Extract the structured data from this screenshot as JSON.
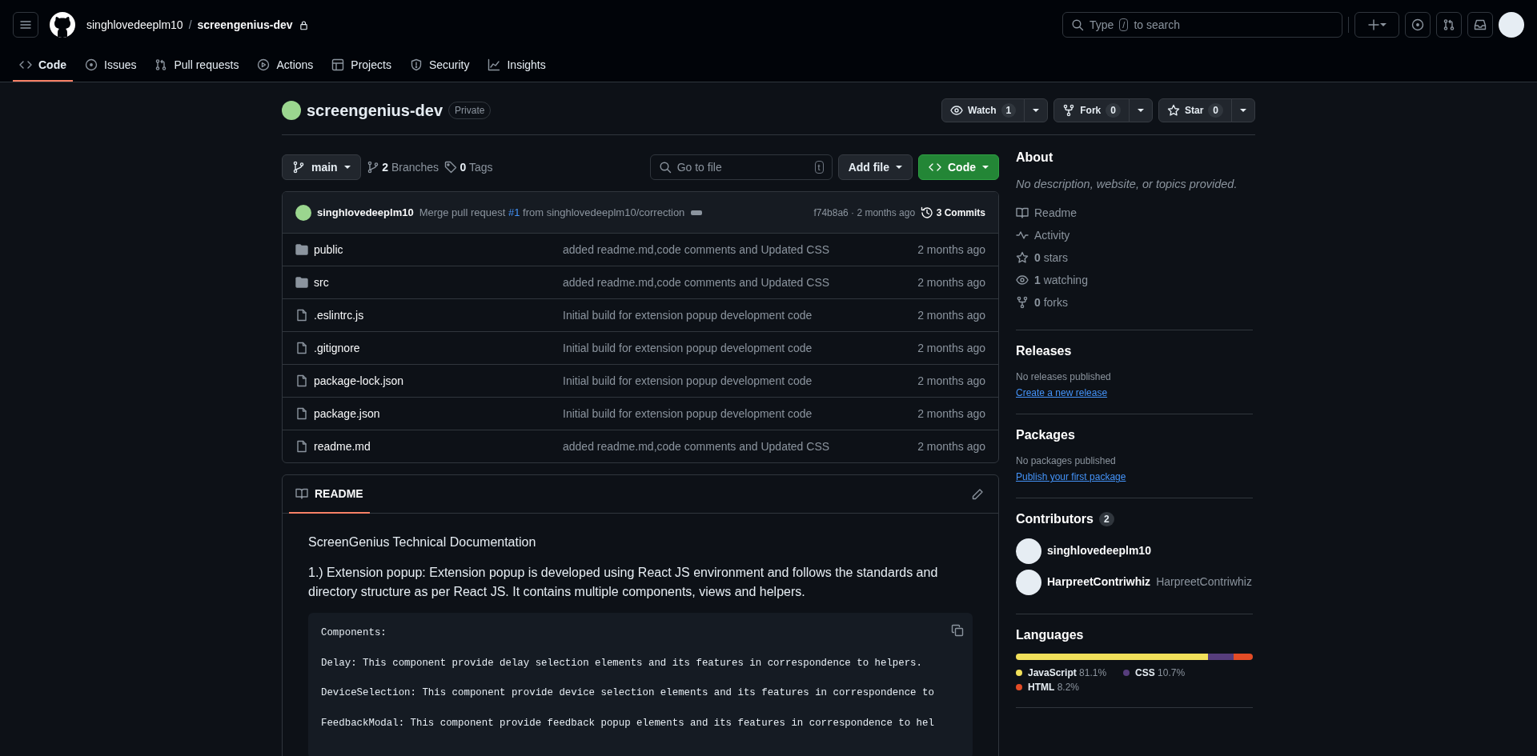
{
  "header": {
    "owner": "singhlovedeeplm10",
    "separator": "/",
    "repo": "screengenius-dev",
    "search": {
      "prefix": "Type",
      "key": "/",
      "suffix": "to search"
    }
  },
  "repo_tabs": [
    {
      "kind": "code",
      "label": "Code",
      "selected": true
    },
    {
      "kind": "issues",
      "label": "Issues",
      "selected": false
    },
    {
      "kind": "pulls",
      "label": "Pull requests",
      "selected": false
    },
    {
      "kind": "actions",
      "label": "Actions",
      "selected": false
    },
    {
      "kind": "projects",
      "label": "Projects",
      "selected": false
    },
    {
      "kind": "security",
      "label": "Security",
      "selected": false
    },
    {
      "kind": "insights",
      "label": "Insights",
      "selected": false
    }
  ],
  "repo": {
    "name": "screengenius-dev",
    "visibility": "Private",
    "actions": [
      {
        "kind": "watch",
        "label": "Watch",
        "count": "1"
      },
      {
        "kind": "fork",
        "label": "Fork",
        "count": "0"
      },
      {
        "kind": "star",
        "label": "Star",
        "count": "0"
      }
    ]
  },
  "toolbar": {
    "branch": "main",
    "branches_count": "2",
    "branches_label": "Branches",
    "tags_count": "0",
    "tags_label": "Tags",
    "go_to_file_placeholder": "Go to file",
    "go_to_file_key": "t",
    "add_file": "Add file",
    "code_button": "Code"
  },
  "latest_commit": {
    "author": "singhlovedeeplm10",
    "message_prefix": "Merge pull request",
    "pr_link": "#1",
    "message_suffix": "from singhlovedeeplm10/correction",
    "hash_time": "f74b8a6 · 2 months ago",
    "commits": "3 Commits"
  },
  "files": [
    {
      "kind": "folder",
      "name": "public",
      "message": "added readme.md,code comments and Updated CSS",
      "time": "2 months ago"
    },
    {
      "kind": "folder",
      "name": "src",
      "message": "added readme.md,code comments and Updated CSS",
      "time": "2 months ago"
    },
    {
      "kind": "file",
      "name": ".eslintrc.js",
      "message": "Initial build for extension popup development code",
      "time": "2 months ago"
    },
    {
      "kind": "file",
      "name": ".gitignore",
      "message": "Initial build for extension popup development code",
      "time": "2 months ago"
    },
    {
      "kind": "file",
      "name": "package-lock.json",
      "message": "Initial build for extension popup development code",
      "time": "2 months ago"
    },
    {
      "kind": "file",
      "name": "package.json",
      "message": "Initial build for extension popup development code",
      "time": "2 months ago"
    },
    {
      "kind": "file",
      "name": "readme.md",
      "message": "added readme.md,code comments and Updated CSS",
      "time": "2 months ago"
    }
  ],
  "readme": {
    "tab": "README",
    "title": "ScreenGenius Technical Documentation",
    "paragraph": "1.) Extension popup: Extension popup is developed using React JS environment and follows the standards and directory structure as per React JS. It contains multiple components, views and helpers.",
    "code_lines": [
      "Components:",
      "Delay: This component provide delay selection elements and its features in correspondence to helpers.",
      "DeviceSelection: This component provide device selection elements and its features in correspondence to",
      "FeedbackModal: This component provide feedback popup elements and its features in correspondence to hel"
    ]
  },
  "about": {
    "title": "About",
    "description": "No description, website, or topics provided.",
    "items": [
      {
        "kind": "readme",
        "label": "Readme"
      },
      {
        "kind": "activity",
        "label": "Activity"
      },
      {
        "kind": "stars",
        "count": "0",
        "label": "stars"
      },
      {
        "kind": "watching",
        "count": "1",
        "label": "watching"
      },
      {
        "kind": "forks",
        "count": "0",
        "label": "forks"
      }
    ]
  },
  "releases": {
    "title": "Releases",
    "note": "No releases published",
    "link": "Create a new release"
  },
  "packages": {
    "title": "Packages",
    "note": "No packages published",
    "link": "Publish your first package"
  },
  "contributors": {
    "title": "Contributors",
    "count": "2",
    "people": [
      {
        "login": "singhlovedeeplm10"
      },
      {
        "login": "HarpreetContriwhiz",
        "name": "HarpreetContriwhiz"
      }
    ]
  },
  "languages": {
    "title": "Languages",
    "items": [
      {
        "name": "JavaScript",
        "percent": "81.1%",
        "color": "#f1e05a"
      },
      {
        "name": "CSS",
        "percent": "10.7%",
        "color": "#563d7c"
      },
      {
        "name": "HTML",
        "percent": "8.2%",
        "color": "#e34c26"
      }
    ]
  }
}
